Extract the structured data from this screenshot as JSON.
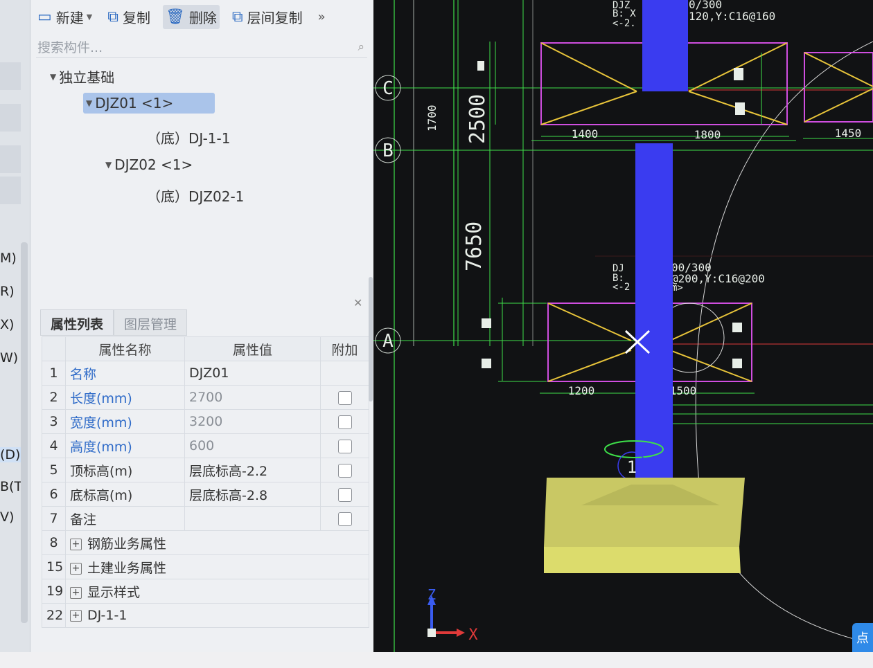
{
  "toolbar": {
    "new_label": "新建",
    "copy_label": "复制",
    "delete_label": "删除",
    "floor_copy_label": "层间复制",
    "more": "»"
  },
  "search": {
    "placeholder": "搜索构件..."
  },
  "tree": {
    "root": "独立基础",
    "items": [
      {
        "label": "DJZ01 <1>"
      },
      {
        "label": "（底）DJ-1-1"
      },
      {
        "label": "DJZ02 <1>"
      },
      {
        "label": "（底）DJZ02-1"
      }
    ]
  },
  "left_strip": {
    "labels": [
      "M)",
      "R)",
      "X)",
      "W)",
      "(D)",
      "B(T)",
      "V)"
    ]
  },
  "tabs": {
    "properties": "属性列表",
    "layers": "图层管理"
  },
  "grid": {
    "headers": {
      "name": "属性名称",
      "value": "属性值",
      "extra": "附加"
    },
    "rows": [
      {
        "idx": "1",
        "name": "名称",
        "value": "DJZ01"
      },
      {
        "idx": "2",
        "name": "长度(mm)",
        "value": "2700"
      },
      {
        "idx": "3",
        "name": "宽度(mm)",
        "value": "3200"
      },
      {
        "idx": "4",
        "name": "高度(mm)",
        "value": "600"
      },
      {
        "idx": "5",
        "name": "顶标高(m)",
        "value": "层底标高-2.2"
      },
      {
        "idx": "6",
        "name": "底标高(m)",
        "value": "层底标高-2.8"
      },
      {
        "idx": "7",
        "name": "备注",
        "value": ""
      },
      {
        "idx": "8",
        "name": "钢筋业务属性"
      },
      {
        "idx": "15",
        "name": "土建业务属性"
      },
      {
        "idx": "19",
        "name": "显示样式"
      },
      {
        "idx": "22",
        "name": "DJ-1-1"
      }
    ]
  },
  "cad": {
    "axes": {
      "c": "C",
      "b": "B",
      "a": "A",
      "one": "1"
    },
    "dims": {
      "d1400": "1400",
      "d1800": "1800",
      "d1450": "1450",
      "d1200": "1200",
      "d1500": "1500",
      "d2500": "2500",
      "d7650": "7650",
      "d1700": "1700"
    },
    "labels": {
      "top1": "DJZ",
      "top2": "B: X",
      "top3": "<-2.",
      "top_right1": "0/300",
      "top_right2": "120,Y:C16@160",
      "mid1": "DJ",
      "mid2": "B:",
      "mid3": "<-2",
      "mid_right1": "00/300",
      "mid_right2": "@200,Y:C16@200",
      "mid_right3": "m>"
    },
    "axis_z": "Z",
    "axis_x": "X",
    "corner_button": "点"
  },
  "colors": {
    "column_blue": "#3a3cf0",
    "dim_green": "#3ee04a",
    "outline_magenta": "#d04ee0",
    "diagonal_yellow": "#e8c43a",
    "footing_yellow": "#d8d86a",
    "select_blue": "#aac4ea"
  }
}
